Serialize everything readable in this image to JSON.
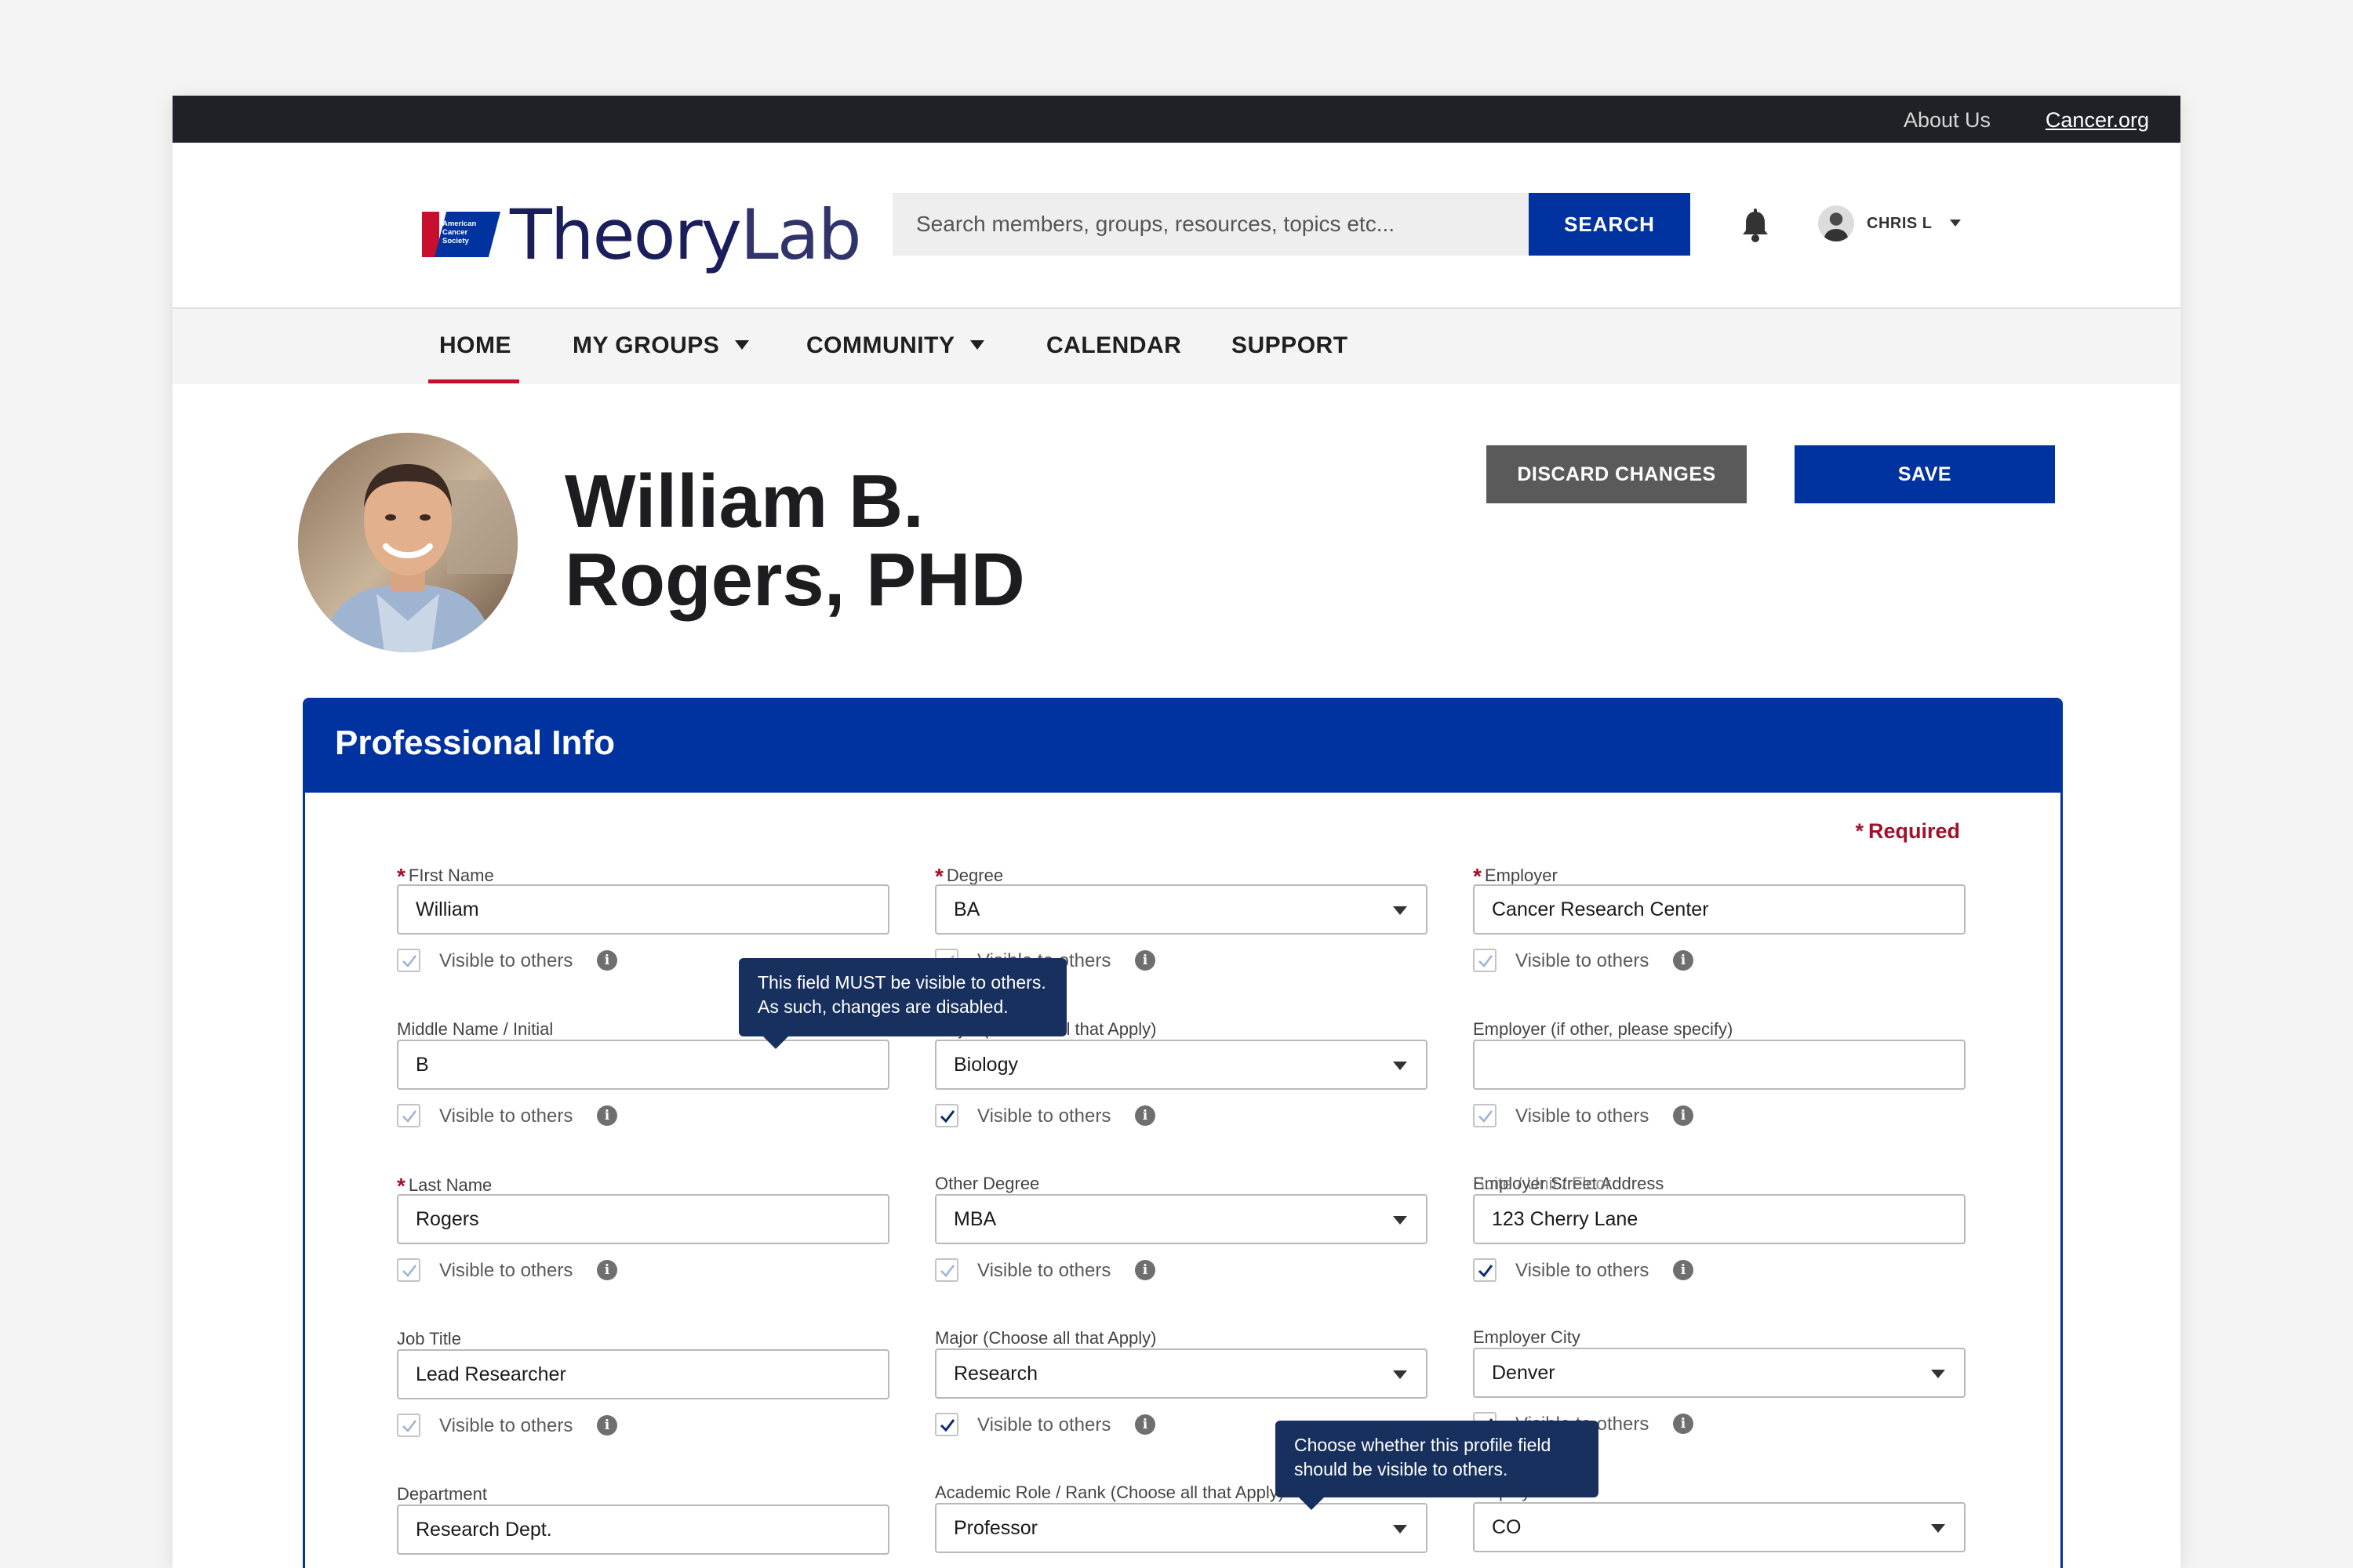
{
  "utility_bar": {
    "about": "About Us",
    "site_link": "Cancer.org"
  },
  "logo": {
    "flag_text": "American Cancer Society",
    "wordmark_theory": "Theory",
    "wordmark_lab": "Lab",
    "tm": "™"
  },
  "search": {
    "placeholder": "Search members, groups, resources, topics etc...",
    "button": "SEARCH"
  },
  "user": {
    "name": "CHRIS L"
  },
  "nav": {
    "items": [
      {
        "label": "HOME",
        "active": true
      },
      {
        "label": "MY GROUPS",
        "dropdown": true
      },
      {
        "label": "COMMUNITY",
        "dropdown": true
      },
      {
        "label": "CALENDAR"
      },
      {
        "label": "SUPPORT"
      }
    ]
  },
  "profile": {
    "name_line1": "William B.",
    "name_line2": "Rogers, PHD"
  },
  "actions": {
    "discard": "DISCARD CHANGES",
    "save": "SAVE"
  },
  "section": {
    "title": "Professional Info",
    "required": "Required"
  },
  "visible_label": "Visible to others",
  "info_glyph": "i",
  "fields": {
    "first_name": {
      "label": "FIrst Name",
      "value": "William",
      "required": true,
      "visible": true
    },
    "middle_name": {
      "label": "Middle  Name / Initial",
      "value": "B",
      "visible": true
    },
    "last_name": {
      "label": "Last Name",
      "value": "Rogers",
      "required": true,
      "visible": true
    },
    "job_title": {
      "label": "Job Title",
      "value": "Lead Researcher",
      "visible": true
    },
    "department": {
      "label": "Department",
      "value": "Research Dept."
    },
    "degree": {
      "label": "Degree",
      "value": "BA",
      "required": true,
      "visible": true
    },
    "major": {
      "label": "Major (Choose all that Apply)",
      "value": "Biology",
      "visible": true
    },
    "other_degree": {
      "label": "Other Degree",
      "value": "MBA",
      "visible": true
    },
    "major2": {
      "label": "Major (Choose all that Apply)",
      "value": "Research",
      "visible": true
    },
    "academic_role": {
      "label": "Academic Role / Rank (Choose all that Apply)",
      "value": "Professor"
    },
    "employer": {
      "label": "Employer",
      "value": "Cancer Research Center",
      "required": true,
      "visible": true
    },
    "employer_other": {
      "label": "Employer (if other, please specify)",
      "value": "",
      "visible": true
    },
    "employer_street": {
      "label": "Employer Street Address",
      "overlap_label": "Suite / Unit / Floor",
      "value": "123 Cherry Lane",
      "visible": true
    },
    "employer_city": {
      "label": "Employer City",
      "value": "Denver",
      "visible": true
    },
    "employer_state": {
      "label": "Employer State",
      "value": "CO"
    }
  },
  "tooltips": {
    "must_visible": "This field MUST be visible to others. As such, changes are disabled.",
    "choose_visible": "Choose whether this profile field should be visible to others."
  },
  "colors": {
    "brand_blue": "#0033a0",
    "acs_red": "#c8102e",
    "required_red": "#a0112b",
    "tooltip_navy": "#17305e",
    "discard_gray": "#5a5a5a"
  }
}
